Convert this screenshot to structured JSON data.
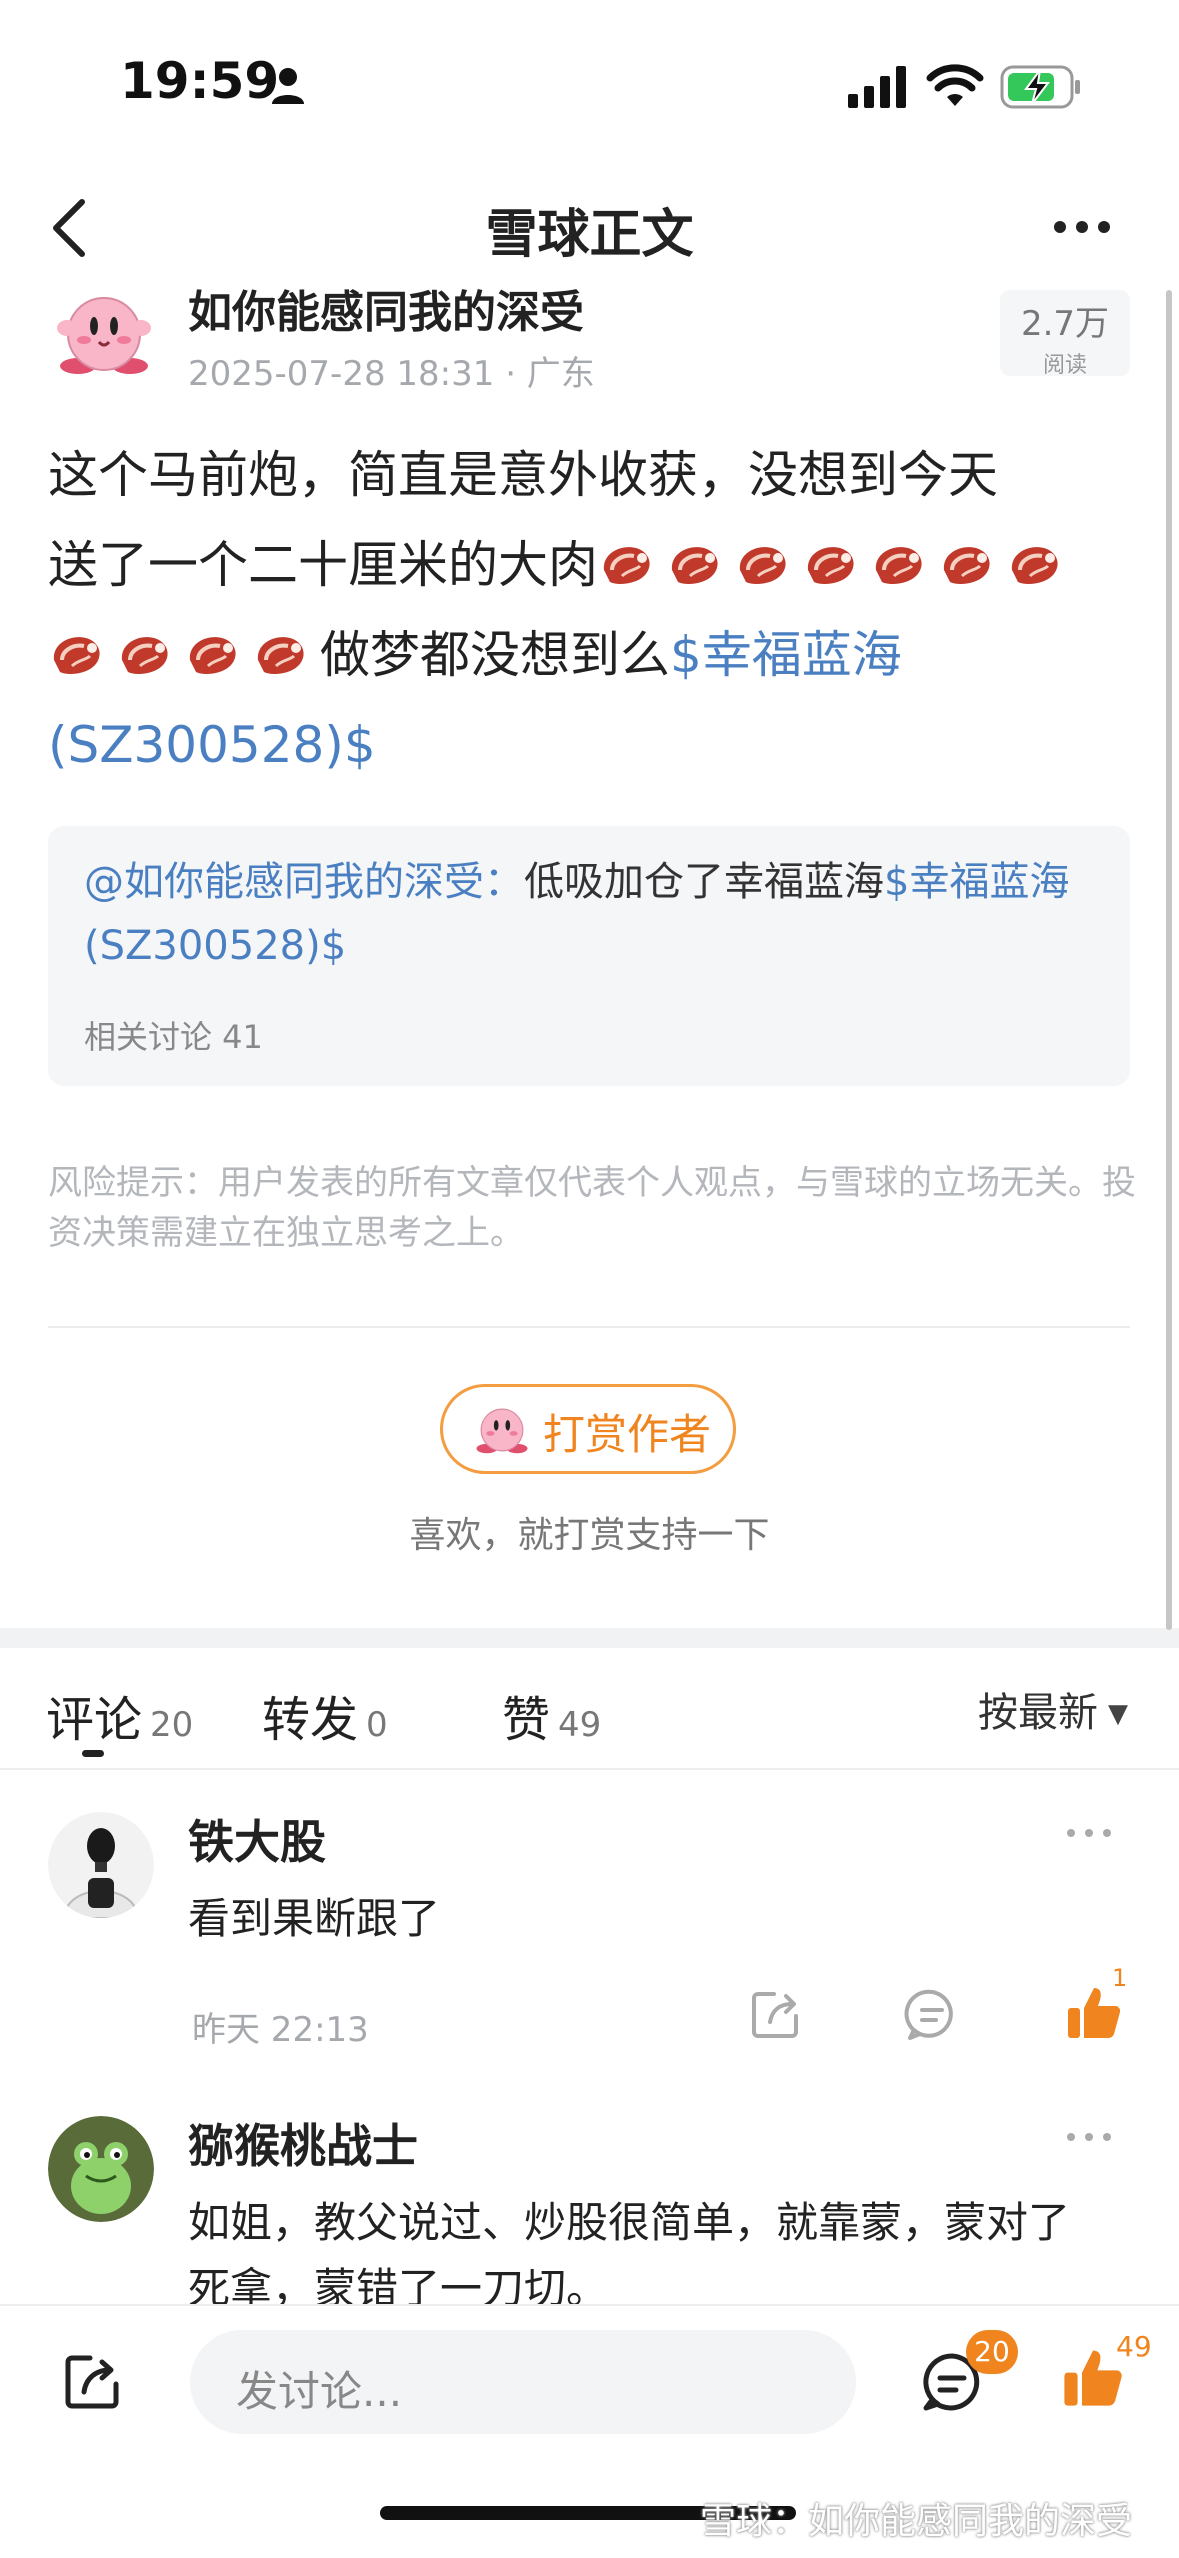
{
  "status_bar": {
    "time": "19:59"
  },
  "nav": {
    "title": "雪球正文"
  },
  "author": {
    "name": "如你能感同我的深受",
    "meta": "2025-07-28 18:31 · 广东",
    "reads_count": "2.7万",
    "reads_label": "阅读"
  },
  "post": {
    "line1": "这个马前炮，简直是意外收获，没想到今天",
    "line2": "送了一个二十厘米的大肉",
    "line3_text": "做梦都没想到么",
    "stock_link": "$幸福蓝海(SZ300528)$"
  },
  "quote": {
    "author": "@如你能感同我的深受：",
    "text": "低吸加仓了幸福蓝海",
    "stock_link": "$幸福蓝海(SZ300528)$",
    "meta": "相关讨论 41"
  },
  "risk_notice": "风险提示：用户发表的所有文章仅代表个人观点，与雪球的立场无关。投资决策需建立在独立思考之上。",
  "reward": {
    "button_label": "打赏作者",
    "hint": "喜欢，就打赏支持一下"
  },
  "tabs": [
    {
      "label": "评论",
      "count": "20"
    },
    {
      "label": "转发",
      "count": "0"
    },
    {
      "label": "赞",
      "count": "49"
    }
  ],
  "sort_label": "按最新",
  "comments": [
    {
      "name": "铁大股",
      "text": "看到果断跟了",
      "time": "昨天 22:13",
      "likes": "1"
    },
    {
      "name": "猕猴桃战士",
      "text": "如姐，教父说过、炒股很简单，就靠蒙，蒙对了死拿，蒙错了一刀切。"
    }
  ],
  "bottom_bar": {
    "input_placeholder": "发讨论...",
    "comment_count": "20",
    "like_count": "49"
  },
  "watermark": "雪球：如你能感同我的深受",
  "colors": {
    "accent": "#f0841f",
    "link": "#4a7fc1",
    "meta_gray": "#a5a8ad"
  }
}
